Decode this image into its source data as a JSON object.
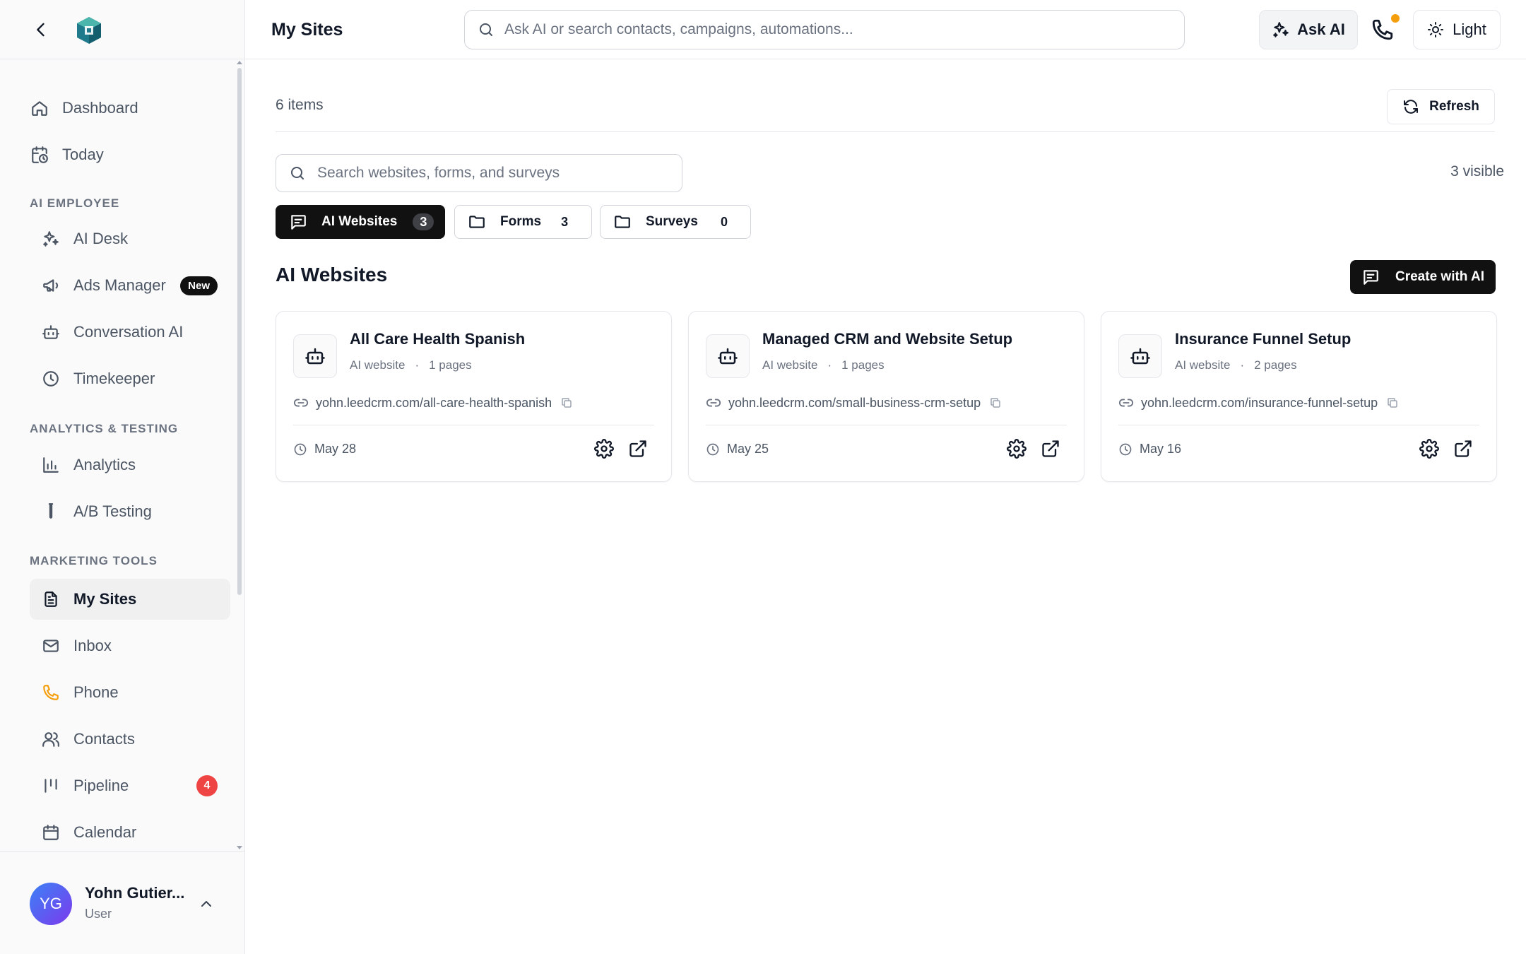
{
  "app": {
    "page_title": "My Sites",
    "brand_color": "#1f7a8c"
  },
  "topbar": {
    "search_placeholder": "Ask AI or search contacts, campaigns, automations...",
    "ask_ai_label": "Ask AI",
    "theme_label": "Light",
    "phone_icon": "phone-icon",
    "notification_dot_color": "#f59e0b"
  },
  "sidebar": {
    "top_items": [
      {
        "label": "Dashboard",
        "icon": "home-icon"
      },
      {
        "label": "Today",
        "icon": "calendar-clock-icon"
      }
    ],
    "sections": [
      {
        "heading": "AI EMPLOYEE",
        "items": [
          {
            "label": "AI Desk",
            "icon": "sparkles-icon"
          },
          {
            "label": "Ads Manager",
            "icon": "megaphone-icon",
            "badge": "New"
          },
          {
            "label": "Conversation AI",
            "icon": "bot-icon"
          },
          {
            "label": "Timekeeper",
            "icon": "clock-icon"
          }
        ]
      },
      {
        "heading": "ANALYTICS & TESTING",
        "items": [
          {
            "label": "Analytics",
            "icon": "bar-chart-icon"
          },
          {
            "label": "A/B Testing",
            "icon": "test-tube-icon"
          }
        ]
      },
      {
        "heading": "MARKETING TOOLS",
        "items": [
          {
            "label": "My Sites",
            "icon": "file-text-icon",
            "active": true
          },
          {
            "label": "Inbox",
            "icon": "mail-icon"
          },
          {
            "label": "Phone",
            "icon": "phone-icon",
            "color": "#f59e0b"
          },
          {
            "label": "Contacts",
            "icon": "users-icon"
          },
          {
            "label": "Pipeline",
            "icon": "kanban-icon",
            "count": "4"
          },
          {
            "label": "Calendar",
            "icon": "calendar-icon"
          }
        ]
      }
    ],
    "user": {
      "initials": "YG",
      "name": "Yohn Gutier...",
      "role": "User"
    }
  },
  "main": {
    "items_count": "6 items",
    "refresh_label": "Refresh",
    "search_placeholder": "Search websites, forms, and surveys",
    "visible_count": "3 visible",
    "tabs": [
      {
        "label": "AI Websites",
        "count": "3",
        "active": true,
        "icon": "message-square-icon"
      },
      {
        "label": "Forms",
        "count": "3",
        "icon": "folder-icon"
      },
      {
        "label": "Surveys",
        "count": "0",
        "icon": "folder-icon"
      }
    ],
    "section_title": "AI Websites",
    "create_label": "Create with AI",
    "cards": [
      {
        "title": "All Care Health Spanish",
        "type": "AI website",
        "dot": "·",
        "pages": "1 pages",
        "url": "yohn.leedcrm.com/all-care-health-spanish",
        "date": "May 28"
      },
      {
        "title": "Managed CRM and Website Setup",
        "type": "AI website",
        "dot": "·",
        "pages": "1 pages",
        "url": "yohn.leedcrm.com/small-business-crm-setup",
        "date": "May 25"
      },
      {
        "title": "Insurance Funnel Setup",
        "type": "AI website",
        "dot": "·",
        "pages": "2 pages",
        "url": "yohn.leedcrm.com/insurance-funnel-setup",
        "date": "May 16"
      }
    ]
  }
}
